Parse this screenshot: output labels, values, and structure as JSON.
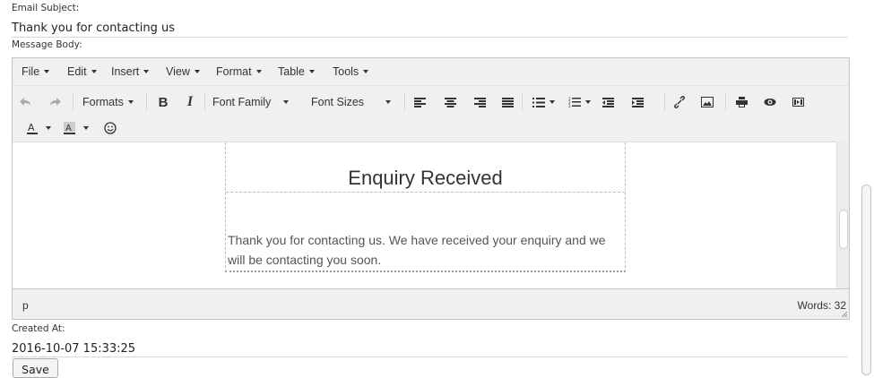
{
  "email_subject": {
    "label": "Email Subject:",
    "value": "Thank you for contacting us"
  },
  "message_body": {
    "label": "Message Body:"
  },
  "editor": {
    "menu": [
      "File",
      "Edit",
      "Insert",
      "View",
      "Format",
      "Table",
      "Tools"
    ],
    "toolbar": {
      "formats": "Formats",
      "bold": "B",
      "italic": "I",
      "font_family": "Font Family",
      "font_sizes": "Font Sizes"
    },
    "content": {
      "heading": "Enquiry Received",
      "body": "Thank you for contacting us. We have received your enquiry and we will be contacting you soon."
    },
    "status": {
      "path": "p",
      "words": "Words: 32"
    }
  },
  "created_at": {
    "label": "Created At:",
    "value": "2016-10-07 15:33:25"
  },
  "save_button": "Save"
}
